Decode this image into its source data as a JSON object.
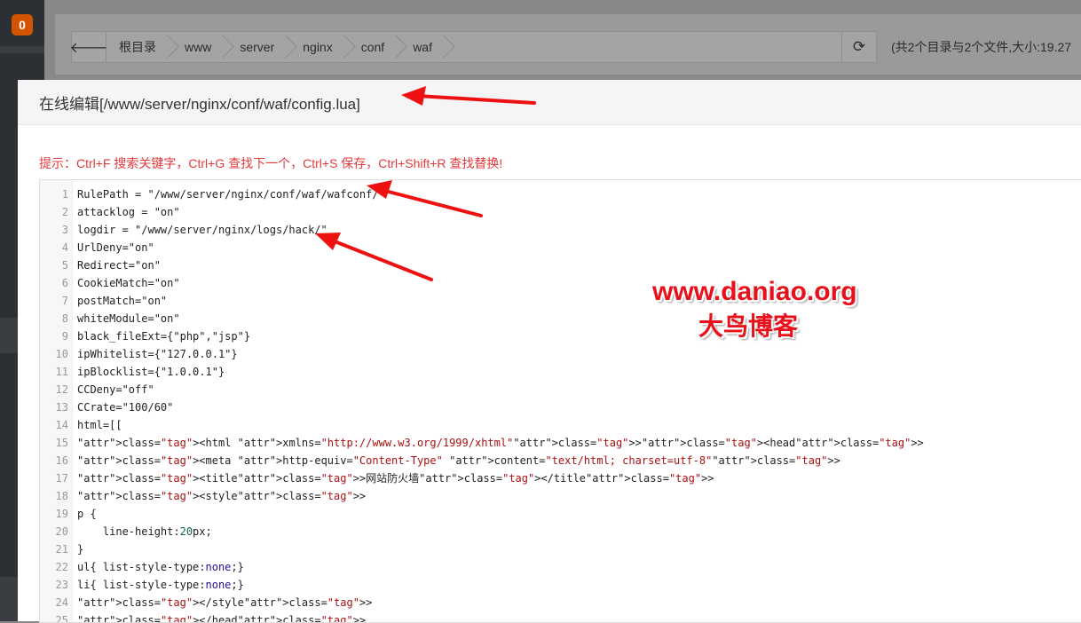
{
  "sidebar": {
    "badge": "0"
  },
  "file_manager": {
    "breadcrumb": [
      "根目录",
      "www",
      "server",
      "nginx",
      "conf",
      "waf"
    ],
    "summary": "(共2个目录与2个文件,大小:19.27"
  },
  "editor_dialog": {
    "title": "在线编辑[/www/server/nginx/conf/waf/config.lua]",
    "hint": "提示：Ctrl+F 搜索关键字，Ctrl+G 查找下一个，Ctrl+S 保存，Ctrl+Shift+R 查找替换!",
    "lines": [
      "RulePath = \"/www/server/nginx/conf/waf/wafconf/\"",
      "attacklog = \"on\"",
      "logdir = \"/www/server/nginx/logs/hack/\"",
      "UrlDeny=\"on\"",
      "Redirect=\"on\"",
      "CookieMatch=\"on\"",
      "postMatch=\"on\"",
      "whiteModule=\"on\"",
      "black_fileExt={\"php\",\"jsp\"}",
      "ipWhitelist={\"127.0.0.1\"}",
      "ipBlocklist={\"1.0.0.1\"}",
      "CCDeny=\"off\"",
      "CCrate=\"100/60\"",
      "html=[[",
      "<html xmlns=\"http://www.w3.org/1999/xhtml\"><head>",
      "<meta http-equiv=\"Content-Type\" content=\"text/html; charset=utf-8\">",
      "<title>网站防火墙</title>",
      "<style>",
      "p {",
      "    line-height:20px;",
      "}",
      "ul{ list-style-type:none;}",
      "li{ list-style-type:none;}",
      "</style>",
      "</head>"
    ]
  },
  "watermark": {
    "site": "www.daniao.org",
    "name": "大鸟博客"
  },
  "colors": {
    "hint": "#e4393c",
    "watermark": "#e8101a",
    "badge": "#d35400"
  }
}
